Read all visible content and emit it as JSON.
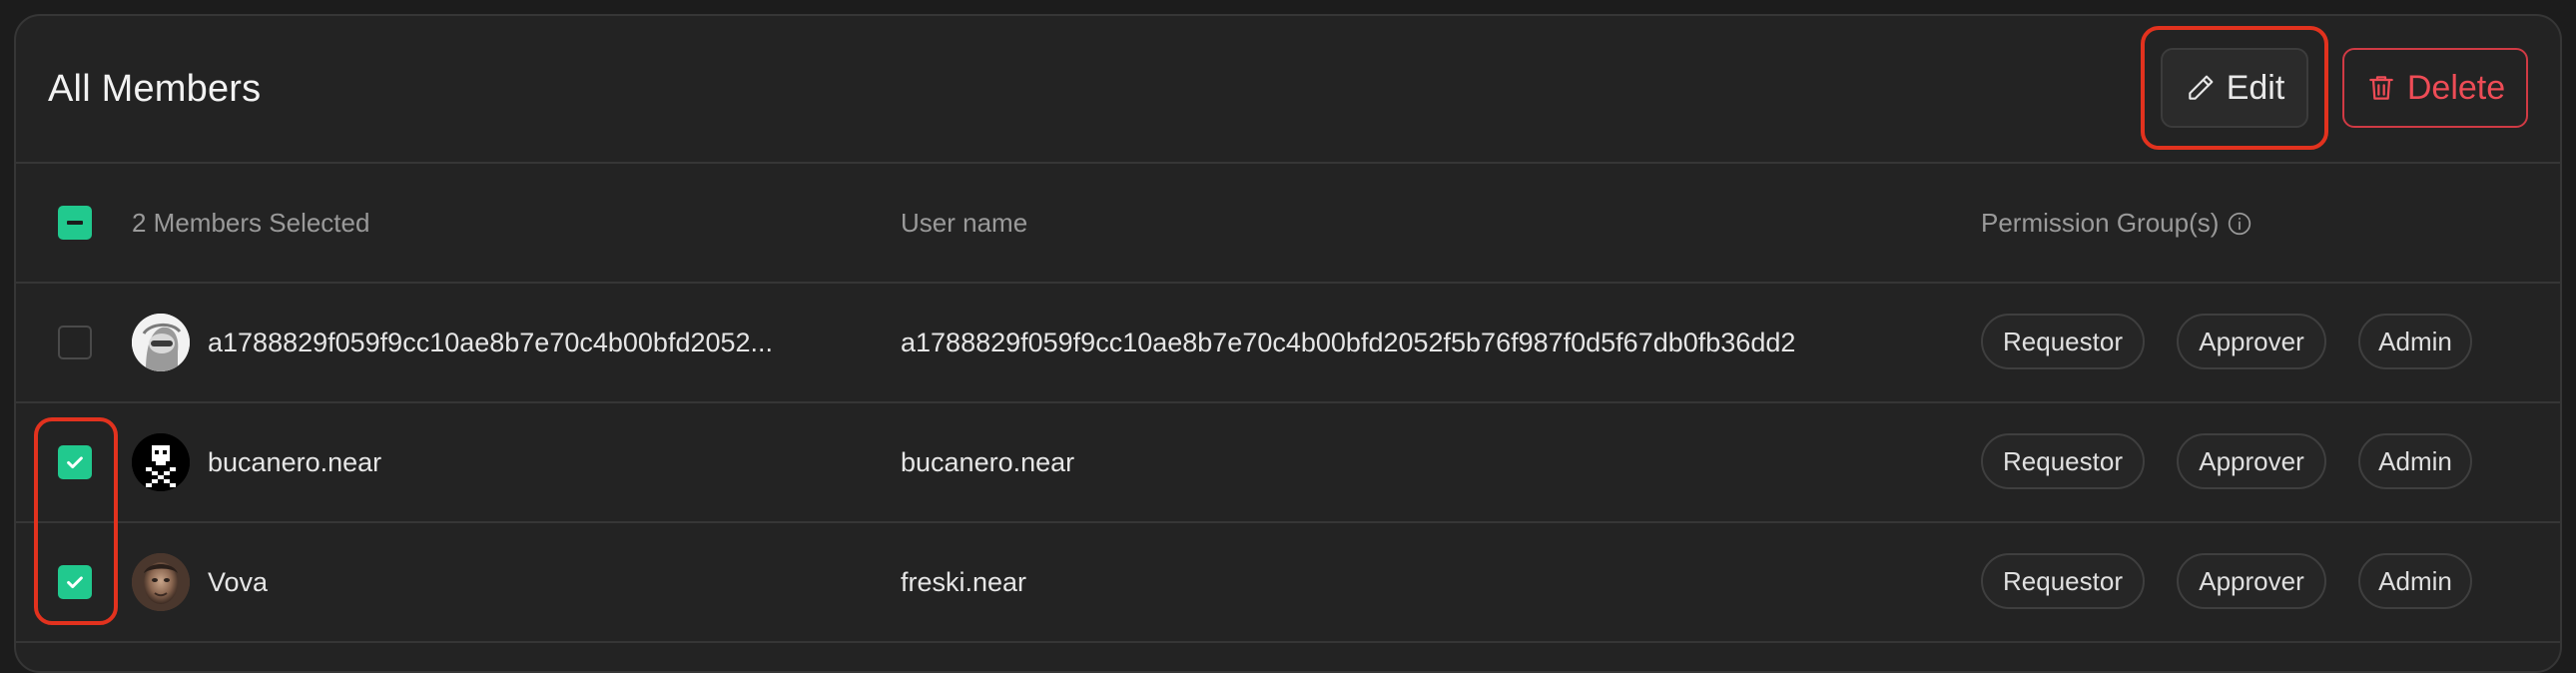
{
  "header": {
    "title": "All Members",
    "edit_label": "Edit",
    "delete_label": "Delete"
  },
  "table": {
    "selection_label": "2 Members Selected",
    "username_header": "User name",
    "permissions_header": "Permission Group(s)",
    "rows": [
      {
        "name": "a1788829f059f9cc10ae8b7e70c4b00bfd2052...",
        "username": "a1788829f059f9cc10ae8b7e70c4b00bfd2052f5b76f987f0d5f67db0fb36dd2",
        "checked": false,
        "avatar": "ghost-avatar",
        "groups": [
          "Requestor",
          "Approver",
          "Admin"
        ]
      },
      {
        "name": "bucanero.near",
        "username": "bucanero.near",
        "checked": true,
        "avatar": "skull-avatar",
        "groups": [
          "Requestor",
          "Approver",
          "Admin"
        ]
      },
      {
        "name": "Vova",
        "username": "freski.near",
        "checked": true,
        "avatar": "photo-avatar",
        "groups": [
          "Requestor",
          "Approver",
          "Admin"
        ]
      }
    ]
  },
  "colors": {
    "accent_green": "#21c98e",
    "danger_red": "#ee4c56",
    "highlight_red": "#e2321e"
  },
  "icons": {
    "edit": "pencil-icon",
    "delete": "trash-icon",
    "info": "info-icon",
    "select_all": "minus-icon",
    "checked": "checkmark-icon"
  }
}
